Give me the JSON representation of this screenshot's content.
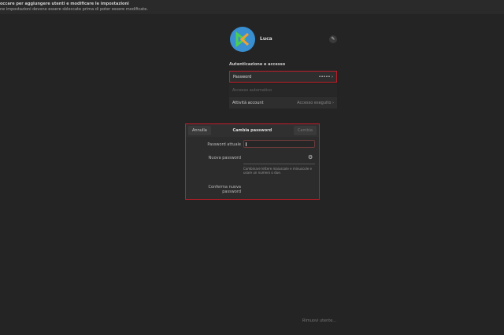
{
  "banner": {
    "title": "occare per aggiungere utenti e modificare le impostazioni",
    "subtitle": "ne impostazioni devono essere sbloccate prima di poter essere modificate."
  },
  "user": {
    "name": "Luca"
  },
  "auth": {
    "section_title": "Autenticazione e accesso",
    "password_label": "Password",
    "password_value": "•••••",
    "auto_login_label": "Accesso automatico",
    "activity_label": "Attività account",
    "activity_value": "Accesso eseguito"
  },
  "dialog": {
    "cancel": "Annulla",
    "title": "Cambia password",
    "confirm": "Cambia",
    "current_label": "Password attuale",
    "new_label": "Nuova password",
    "confirm_label": "Conferma nuova password",
    "hint": "Combinare lettere maiuscole e minuscole e usare un numero o due."
  },
  "footer": {
    "remove_user": "Rimuovi utente..."
  },
  "colors": {
    "highlight": "#c01c28",
    "avatar": "#3a8fd0"
  }
}
